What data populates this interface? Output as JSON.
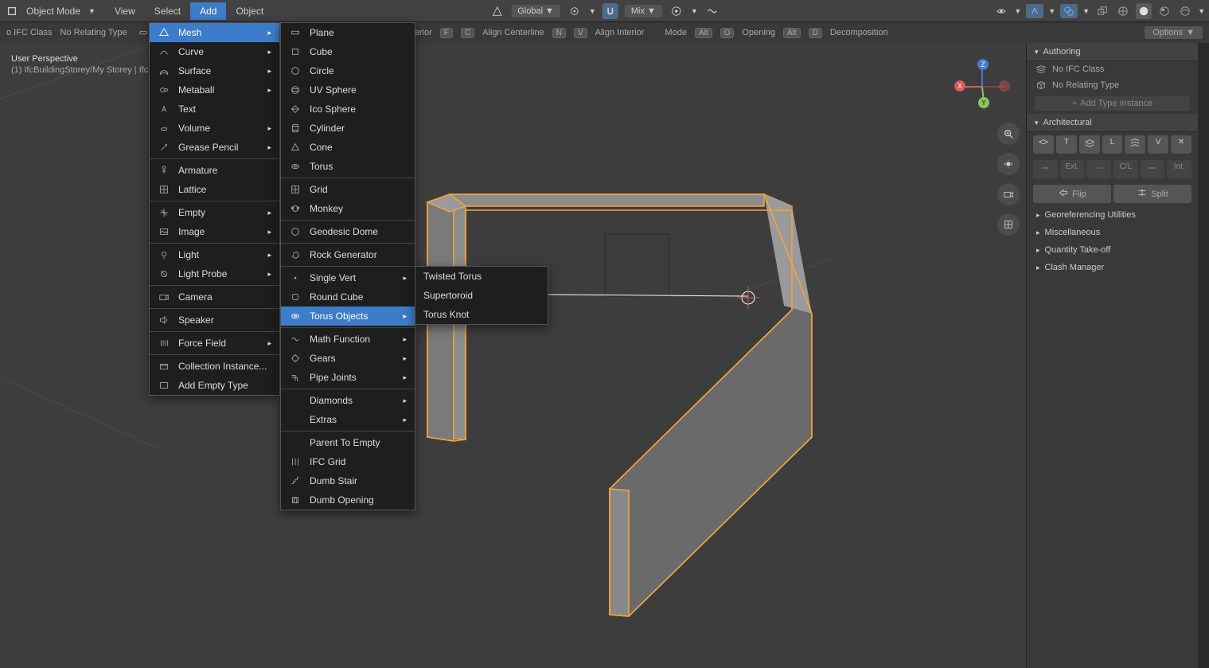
{
  "header": {
    "mode": "Object Mode",
    "menu": {
      "view": "View",
      "select": "Select",
      "add": "Add",
      "object": "Object"
    },
    "global": "Global",
    "mix": "Mix"
  },
  "sub_header": {
    "ifc_class": "o IFC Class",
    "relating_type": "No Relating Type",
    "exterior": "xterior",
    "centerline": "Align Centerline",
    "interior": "Align Interior",
    "mode": "Mode",
    "opening": "Opening",
    "decomposition": "Decomposition",
    "options": "Options",
    "keys": {
      "alt1": "Alt",
      "c": "C",
      "alt2": "Alt",
      "o": "O",
      "alt3": "Alt",
      "d": "D",
      "f": "F",
      "v": "V"
    }
  },
  "overlay": {
    "perspective": "User Perspective",
    "context": "(1) IfcBuildingStorey/My Storey | Ifc"
  },
  "add_menu": {
    "mesh": "Mesh",
    "curve": "Curve",
    "surface": "Surface",
    "metaball": "Metaball",
    "text": "Text",
    "volume": "Volume",
    "grease": "Grease Pencil",
    "armature": "Armature",
    "lattice": "Lattice",
    "empty": "Empty",
    "image": "Image",
    "light": "Light",
    "light_probe": "Light Probe",
    "camera": "Camera",
    "speaker": "Speaker",
    "force": "Force Field",
    "collection": "Collection Instance...",
    "empty_type": "Add Empty Type"
  },
  "mesh_menu": {
    "plane": "Plane",
    "cube": "Cube",
    "circle": "Circle",
    "uv_sphere": "UV Sphere",
    "ico_sphere": "Ico Sphere",
    "cylinder": "Cylinder",
    "cone": "Cone",
    "torus": "Torus",
    "grid": "Grid",
    "monkey": "Monkey",
    "geodesic": "Geodesic Dome",
    "rock": "Rock Generator",
    "single_vert": "Single Vert",
    "round_cube": "Round Cube",
    "torus_objects": "Torus Objects",
    "math": "Math Function",
    "gears": "Gears",
    "pipe": "Pipe Joints",
    "diamonds": "Diamonds",
    "extras": "Extras",
    "parent_empty": "Parent To Empty",
    "ifc_grid": "IFC Grid",
    "dumb_stair": "Dumb Stair",
    "dumb_opening": "Dumb Opening"
  },
  "torus_menu": {
    "twisted": "Twisted Torus",
    "supertoroid": "Supertoroid",
    "knot": "Torus Knot"
  },
  "right_panel": {
    "authoring": "Authoring",
    "no_ifc_class": "No IFC Class",
    "no_relating_type": "No Relating Type",
    "add_type_instance": "Add Type Instance",
    "architectural": "Architectural",
    "btns": {
      "t": "T",
      "l": "L",
      "v": "V"
    },
    "ext": "Ext.",
    "cl": "C/L",
    "int": "Int.",
    "flip": "Flip",
    "split": "Split",
    "georeferencing": "Georeferencing Utilities",
    "misc": "Miscellaneous",
    "quantity": "Quantity Take-off",
    "clash": "Clash Manager"
  },
  "gizmo": {
    "z": "Z",
    "x": "X",
    "y": "Y"
  }
}
